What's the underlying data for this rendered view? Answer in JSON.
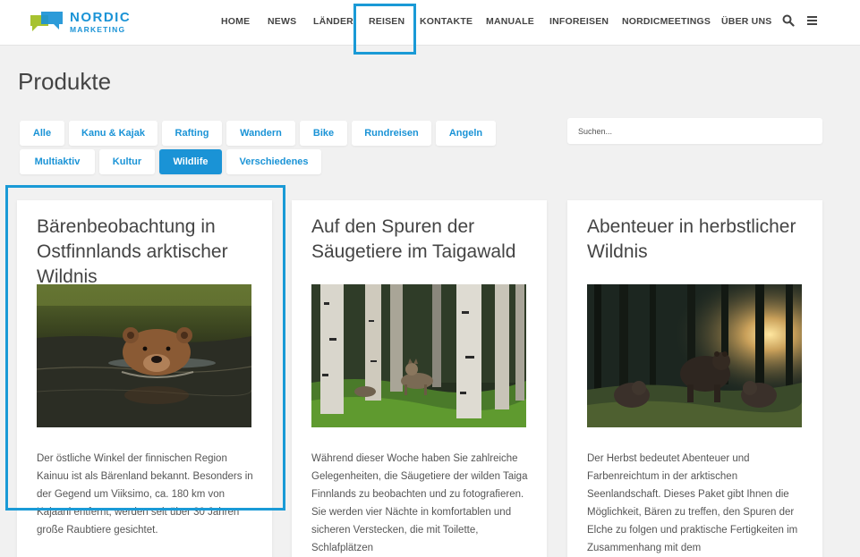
{
  "brand": {
    "word1": "NORDIC",
    "word2": "MARKETING",
    "colors": {
      "accent": "#1a93d6",
      "logo_green": "#a7c230",
      "logo_blue": "#1a93d6"
    }
  },
  "nav": {
    "items": [
      {
        "label": "HOME"
      },
      {
        "label": "NEWS"
      },
      {
        "label": "LÄNDER"
      },
      {
        "label": "REISEN"
      },
      {
        "label": "KONTAKTE"
      },
      {
        "label": "MANUALE"
      },
      {
        "label": "INFOREISEN"
      },
      {
        "label": "NORDICMEETINGS"
      },
      {
        "label": "ÜBER UNS"
      }
    ],
    "search_icon": "search-icon",
    "menu_icon": "hamburger-menu-icon"
  },
  "page": {
    "title": "Produkte"
  },
  "filters": [
    {
      "label": "Alle"
    },
    {
      "label": "Kanu & Kajak"
    },
    {
      "label": "Rafting"
    },
    {
      "label": "Wandern"
    },
    {
      "label": "Bike"
    },
    {
      "label": "Rundreisen"
    },
    {
      "label": "Angeln"
    },
    {
      "label": "Multiaktiv"
    },
    {
      "label": "Kultur"
    },
    {
      "label": "Wildlife",
      "active": true
    },
    {
      "label": "Verschiedenes"
    }
  ],
  "search": {
    "placeholder": "Suchen..."
  },
  "products": [
    {
      "title": "Bärenbeobachtung in Ostfinnlands arktischer Wildnis",
      "image": "bear-swimming-photo",
      "text": "Der östliche Winkel der finnischen Region Kainuu ist als Bärenland bekannt. Besonders in der Gegend um Viiksimo, ca. 180 km von Kajaani entfernt, werden seit über 30 Jahren große Raubtiere gesichtet."
    },
    {
      "title": "Auf den Spuren der Säugetiere im Taigawald",
      "image": "wolf-in-birch-forest-photo",
      "text": "Während dieser Woche haben Sie zahlreiche Gelegenheiten, die Säugetiere der wilden Taiga Finnlands zu beobachten und zu fotografieren. Sie werden vier Nächte in komfortablen und sicheren Verstecken, die mit Toilette, Schlafplätzen"
    },
    {
      "title": "Abenteuer in herbstlicher Wildnis",
      "image": "bears-in-autumn-forest-photo",
      "text": "Der Herbst bedeutet Abenteuer und Farbenreichtum in der arktischen Seenlandschaft. Dieses Paket gibt Ihnen die Möglichkeit, Bären zu treffen, den Spuren der Elche zu folgen und praktische Fertigkeiten im Zusammenhang mit dem"
    }
  ],
  "highlight_color": "#1a9ad6"
}
